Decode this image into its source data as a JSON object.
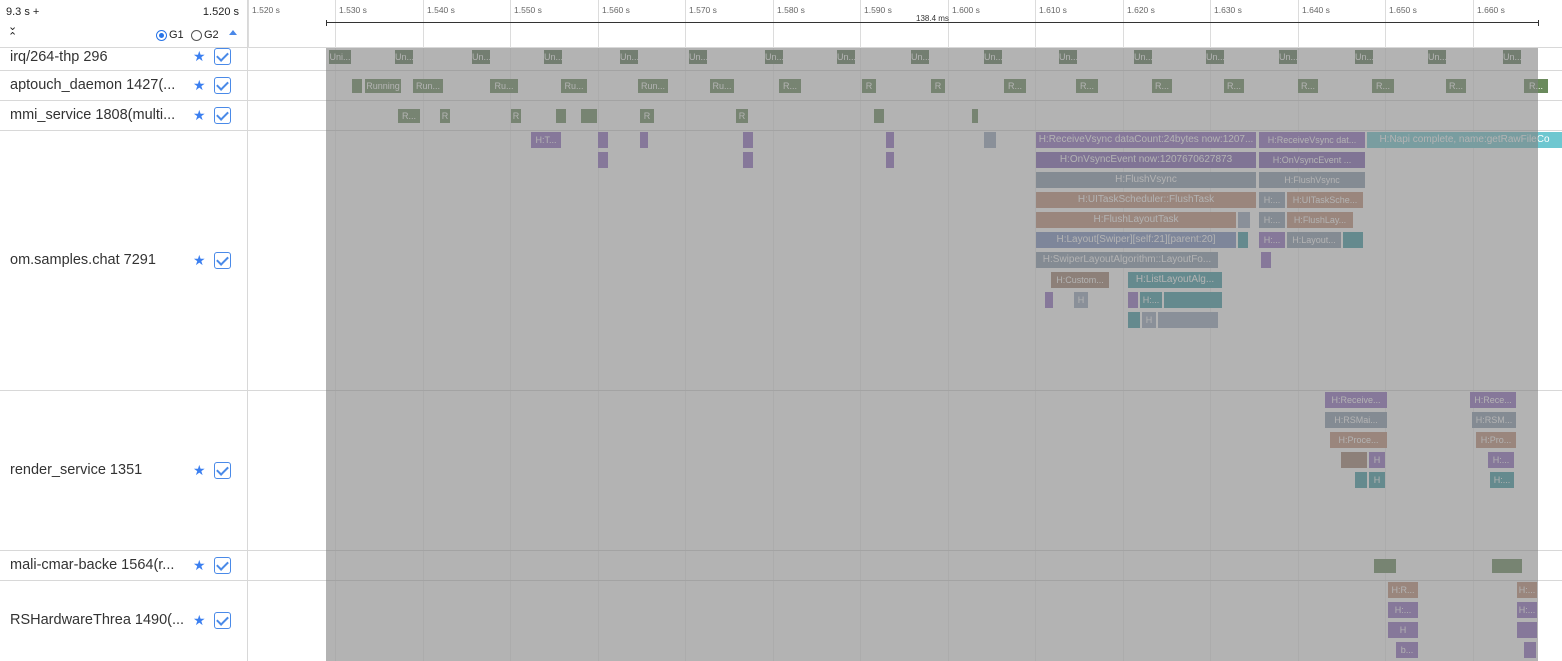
{
  "header": {
    "zoom_label": "9.3 s +",
    "start_time": "1.520 s",
    "group1": "G1",
    "group2": "G2",
    "selection_duration": "138.4 ms"
  },
  "ticks": [
    "1.520 s",
    "1.530 s",
    "1.540 s",
    "1.550 s",
    "1.560 s",
    "1.570 s",
    "1.580 s",
    "1.590 s",
    "1.600 s",
    "1.610 s",
    "1.620 s",
    "1.630 s",
    "1.640 s",
    "1.650 s",
    "1.660 s"
  ],
  "rows": [
    {
      "name": "irq/264-thp 296"
    },
    {
      "name": "aptouch_daemon 1427(..."
    },
    {
      "name": "mmi_service 1808(multi..."
    },
    {
      "name": "om.samples.chat 7291"
    },
    {
      "name": "render_service 1351"
    },
    {
      "name": "mali-cmar-backe 1564(r..."
    },
    {
      "name": "RSHardwareThrea 1490(..."
    }
  ],
  "slices": {
    "irq": "Uni...",
    "irq_short": "Un...",
    "running": "Running",
    "run": "Run...",
    "ru": "Ru...",
    "r": "R",
    "r_dots": "R...",
    "receive_vsync": "H:ReceiveVsync dataCount:24bytes now:1207...",
    "receive_vsync2": "H:ReceiveVsync dat...",
    "napi": "H:Napi complete, name:getRawFileCo",
    "on_vsync": "H:OnVsyncEvent now:1207670627873",
    "on_vsync2": "H:OnVsyncEvent ...",
    "flush_vsync": "H:FlushVsync",
    "ui_task": "H:UITaskScheduler::FlushTask",
    "ui_task2": "H:UITaskSche...",
    "flush_layout": "H:FlushLayoutTask",
    "flush_layout2": "H:FlushLay...",
    "layout_swiper": "H:Layout[Swiper][self:21][parent:20]",
    "layout2": "H:Layout...",
    "swiper_algo": "H:SwiperLayoutAlgorithm::LayoutFo...",
    "custom": "H:Custom...",
    "list_layout": "H:ListLayoutAlg...",
    "h_t": "H:T...",
    "h_dots": "H:...",
    "h": "H",
    "rs_receive": "H:Receive...",
    "rs_rece": "H:Rece...",
    "rs_main": "H:RSMai...",
    "rs_rsm": "H:RSM...",
    "rs_proce": "H:Proce...",
    "rs_pro": "H:Pro...",
    "hw_r": "H:R...",
    "b": "b..."
  }
}
